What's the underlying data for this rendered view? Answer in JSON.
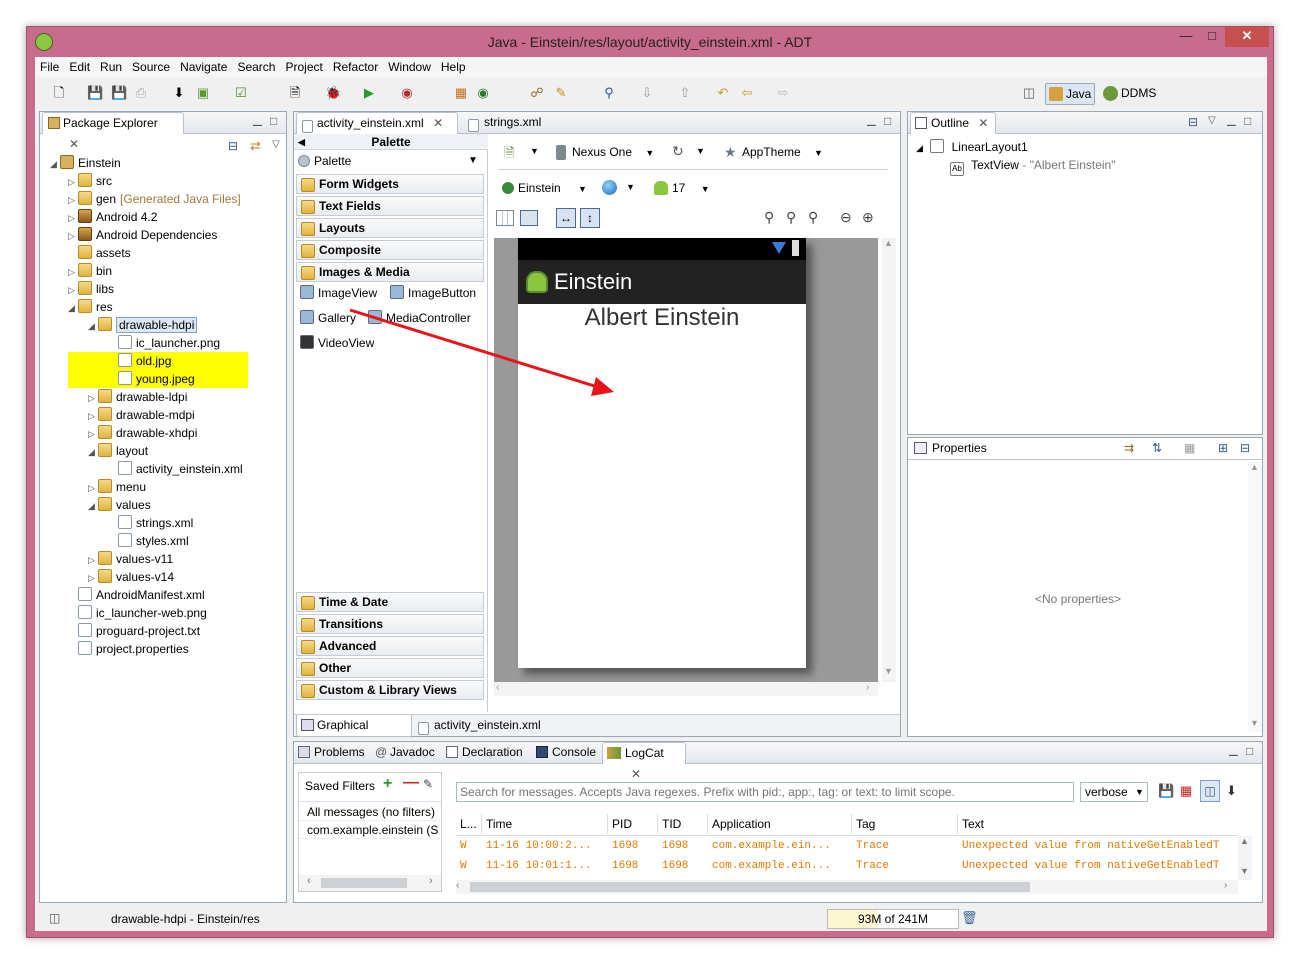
{
  "window": {
    "title": "Java - Einstein/res/layout/activity_einstein.xml - ADT"
  },
  "menu": [
    "File",
    "Edit",
    "Run",
    "Source",
    "Navigate",
    "Search",
    "Project",
    "Refactor",
    "Window",
    "Help"
  ],
  "perspectives": {
    "java": "Java",
    "ddms": "DDMS"
  },
  "package_explorer": {
    "title": "Package Explorer",
    "tree": [
      {
        "label": "Einstein",
        "depth": 0,
        "icon": "project",
        "exp": "open"
      },
      {
        "label": "src",
        "depth": 1,
        "icon": "folder",
        "exp": "closed"
      },
      {
        "label": "gen",
        "suffix": "[Generated Java Files]",
        "depth": 1,
        "icon": "folder",
        "exp": "closed"
      },
      {
        "label": "Android 4.2",
        "depth": 1,
        "icon": "lib",
        "exp": "closed"
      },
      {
        "label": "Android Dependencies",
        "depth": 1,
        "icon": "lib",
        "exp": "closed"
      },
      {
        "label": "assets",
        "depth": 1,
        "icon": "folder",
        "exp": ""
      },
      {
        "label": "bin",
        "depth": 1,
        "icon": "folder",
        "exp": "closed"
      },
      {
        "label": "libs",
        "depth": 1,
        "icon": "folder",
        "exp": "closed"
      },
      {
        "label": "res",
        "depth": 1,
        "icon": "folder",
        "exp": "open"
      },
      {
        "label": "drawable-hdpi",
        "depth": 2,
        "icon": "folder",
        "exp": "open",
        "selected": true
      },
      {
        "label": "ic_launcher.png",
        "depth": 3,
        "icon": "file",
        "exp": ""
      },
      {
        "label": "old.jpg",
        "depth": 3,
        "icon": "file",
        "exp": "",
        "highlight": true
      },
      {
        "label": "young.jpeg",
        "depth": 3,
        "icon": "file",
        "exp": "",
        "highlight": true
      },
      {
        "label": "drawable-ldpi",
        "depth": 2,
        "icon": "folder",
        "exp": "closed"
      },
      {
        "label": "drawable-mdpi",
        "depth": 2,
        "icon": "folder",
        "exp": "closed"
      },
      {
        "label": "drawable-xhdpi",
        "depth": 2,
        "icon": "folder",
        "exp": "closed"
      },
      {
        "label": "layout",
        "depth": 2,
        "icon": "folder",
        "exp": "open"
      },
      {
        "label": "activity_einstein.xml",
        "depth": 3,
        "icon": "file",
        "exp": ""
      },
      {
        "label": "menu",
        "depth": 2,
        "icon": "folder",
        "exp": "closed"
      },
      {
        "label": "values",
        "depth": 2,
        "icon": "folder",
        "exp": "open"
      },
      {
        "label": "strings.xml",
        "depth": 3,
        "icon": "file",
        "exp": ""
      },
      {
        "label": "styles.xml",
        "depth": 3,
        "icon": "file",
        "exp": ""
      },
      {
        "label": "values-v11",
        "depth": 2,
        "icon": "folder",
        "exp": "closed"
      },
      {
        "label": "values-v14",
        "depth": 2,
        "icon": "folder",
        "exp": "closed"
      },
      {
        "label": "AndroidManifest.xml",
        "depth": 1,
        "icon": "file",
        "exp": ""
      },
      {
        "label": "ic_launcher-web.png",
        "depth": 1,
        "icon": "file",
        "exp": ""
      },
      {
        "label": "proguard-project.txt",
        "depth": 1,
        "icon": "file",
        "exp": ""
      },
      {
        "label": "project.properties",
        "depth": 1,
        "icon": "file",
        "exp": ""
      }
    ]
  },
  "editor": {
    "tabs": [
      "activity_einstein.xml",
      "strings.xml"
    ],
    "bottom_tabs": [
      "Graphical Layout",
      "activity_einstein.xml"
    ],
    "palette": {
      "header": "Palette",
      "dropdown": "Palette",
      "categories_top": [
        "Form Widgets",
        "Text Fields",
        "Layouts",
        "Composite",
        "Images & Media"
      ],
      "items": [
        "ImageView",
        "ImageButton",
        "Gallery",
        "MediaController",
        "VideoView"
      ],
      "categories_bottom": [
        "Time & Date",
        "Transitions",
        "Advanced",
        "Other",
        "Custom & Library Views"
      ]
    },
    "config": {
      "device": "Nexus One",
      "theme": "AppTheme",
      "activity": "Einstein",
      "api": "17"
    },
    "device_preview": {
      "app_title": "Einstein",
      "text": "Albert Einstein"
    }
  },
  "outline": {
    "title": "Outline",
    "root": "LinearLayout1",
    "child": "TextView",
    "child_value": " - \"Albert Einstein\""
  },
  "properties": {
    "title": "Properties",
    "empty": "<No properties>"
  },
  "bottom": {
    "tabs": [
      "Problems",
      "Javadoc",
      "Declaration",
      "Console",
      "LogCat"
    ],
    "saved_filters": "Saved Filters",
    "filters": [
      "All messages (no filters)",
      "com.example.einstein (S"
    ],
    "search_placeholder": "Search for messages. Accepts Java regexes. Prefix with pid:, app:, tag: or text: to limit scope.",
    "level": "verbose",
    "columns": [
      "L...",
      "Time",
      "PID",
      "TID",
      "Application",
      "Tag",
      "Text"
    ],
    "rows": [
      [
        "W",
        "11-16 10:00:2...",
        "1698",
        "1698",
        "com.example.ein...",
        "Trace",
        "Unexpected value from nativeGetEnabledT"
      ],
      [
        "W",
        "11-16 10:01:1...",
        "1698",
        "1698",
        "com.example.ein...",
        "Trace",
        "Unexpected value from nativeGetEnabledT"
      ]
    ]
  },
  "status": {
    "selection": "drawable-hdpi - Einstein/res",
    "memory": "93M of 241M"
  },
  "colors": {
    "frame": "#c96b8c",
    "highlight": "#ffff00",
    "arrow": "#e8141c",
    "log_warn": "#e07a00"
  }
}
